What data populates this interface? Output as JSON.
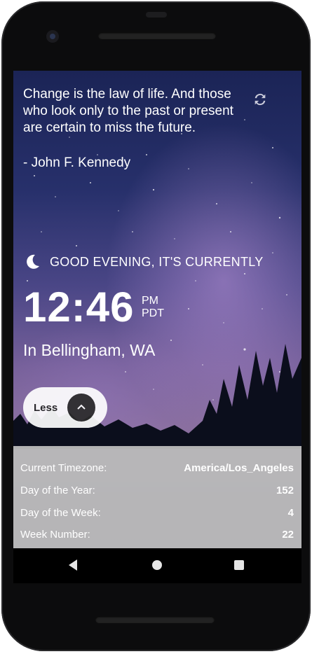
{
  "quote": {
    "text": "Change is the law of life. And those who look only to the past or present are certain to miss the future.",
    "author": "- John F. Kennedy"
  },
  "clock": {
    "greeting": "GOOD EVENING, IT'S CURRENTLY",
    "time": "12:46",
    "ampm": "PM",
    "zone": "PDT",
    "location": "In Bellingham, WA"
  },
  "toggle": {
    "label": "Less"
  },
  "details": [
    {
      "label": "Current Timezone:",
      "value": "America/Los_Angeles"
    },
    {
      "label": "Day of the Year:",
      "value": "152"
    },
    {
      "label": "Day of the Week:",
      "value": "4"
    },
    {
      "label": "Week Number:",
      "value": "22"
    }
  ],
  "colors": {
    "panel_bg": "#b9b9b9",
    "button_bg": "#ffffff",
    "button_icon_bg": "#2c2c2c"
  },
  "icons": [
    "refresh-icon",
    "moon-icon",
    "chevron-up-icon",
    "nav-back-icon",
    "nav-home-icon",
    "nav-recents-icon"
  ]
}
